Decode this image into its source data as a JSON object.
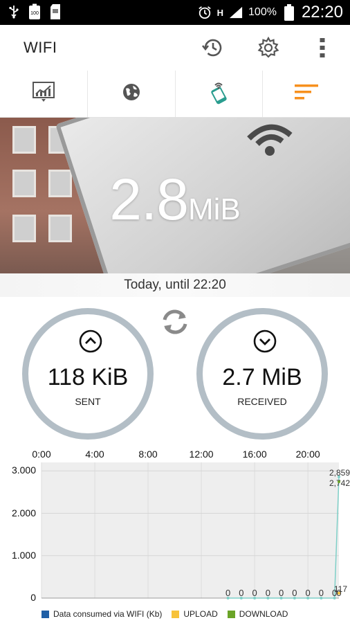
{
  "status_bar": {
    "battery_icon_label": "100",
    "battery_percent": "100%",
    "time": "22:20",
    "network": "H"
  },
  "app": {
    "title": "WIFI"
  },
  "appbar_icons": [
    "history-icon",
    "settings-gear-icon",
    "overflow-menu-icon"
  ],
  "tabs": [
    {
      "icon": "chart-report-icon",
      "active": false
    },
    {
      "icon": "globe-icon",
      "active": false
    },
    {
      "icon": "phone-wifi-icon",
      "active": false
    },
    {
      "icon": "sort-lines-icon",
      "active": true
    }
  ],
  "hero": {
    "total_value": "2.8",
    "total_unit": "MiB"
  },
  "period_label": "Today, until 22:20",
  "sent": {
    "value": "118 KiB",
    "label": "SENT"
  },
  "received": {
    "value": "2.7 MiB",
    "label": "RECEIVED"
  },
  "colors": {
    "accent_orange": "#f7901e",
    "accent_teal": "#2a9d8f",
    "ring": "#b3bec6",
    "series_wifi": "#1f5fa6",
    "series_upload": "#f7c23a",
    "series_download": "#6aa427"
  },
  "chart_data": {
    "type": "line",
    "x_ticks": [
      "0:00",
      "4:00",
      "8:00",
      "12:00",
      "16:00",
      "20:00"
    ],
    "y_ticks": [
      "3.000",
      "2.000",
      "1.000",
      "0"
    ],
    "ylim": [
      0,
      3200
    ],
    "x_range_hours": [
      0,
      22.33
    ],
    "grid": true,
    "legend_position": "bottom",
    "series": [
      {
        "name": "Data consumed via WIFI (Kb)",
        "x": [
          14,
          15,
          16,
          17,
          18,
          19,
          20,
          21,
          22,
          22.33
        ],
        "values": [
          0,
          0,
          0,
          0,
          0,
          0,
          0,
          0,
          0,
          2859
        ]
      },
      {
        "name": "UPLOAD",
        "x": [
          22.33
        ],
        "values": [
          117
        ]
      },
      {
        "name": "DOWNLOAD",
        "x": [
          22.33
        ],
        "values": [
          2742
        ]
      }
    ],
    "point_labels": {
      "zeros": [
        "0",
        "0",
        "0",
        "0",
        "0",
        "0",
        "0",
        "0",
        "0",
        "0"
      ],
      "top_a": "2,859",
      "top_b": "2,742",
      "small": "117"
    }
  }
}
